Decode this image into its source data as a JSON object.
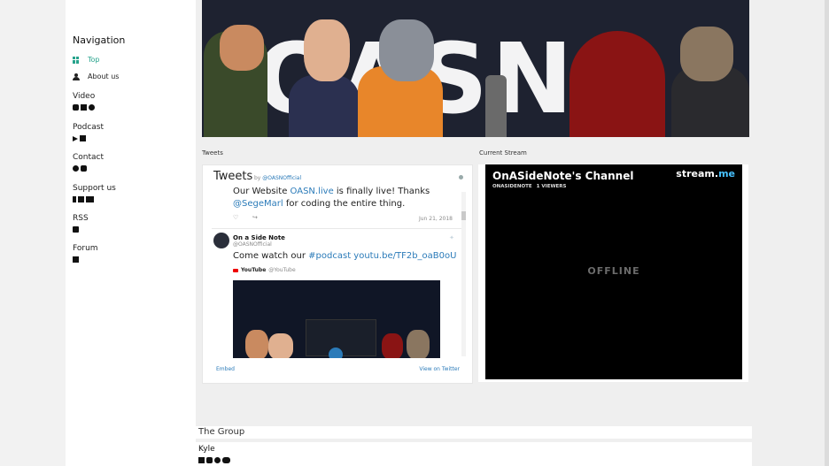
{
  "sidebar": {
    "title": "Navigation",
    "links": [
      {
        "label": "Top",
        "icon": "grid-icon",
        "active": true
      },
      {
        "label": "About us",
        "icon": "person-icon",
        "active": false
      }
    ],
    "sections": [
      {
        "label": "Video",
        "icons": [
          "youtube-icon",
          "twitch-icon",
          "instagram-icon"
        ]
      },
      {
        "label": "Podcast",
        "icons": [
          "google-play-icon",
          "podcast-icon"
        ]
      },
      {
        "label": "Contact",
        "icons": [
          "twitter-icon",
          "discord-icon"
        ]
      },
      {
        "label": "Support us",
        "icons": [
          "patreon-icon",
          "kofi-icon",
          "shop-icon"
        ]
      },
      {
        "label": "RSS",
        "icons": [
          "rss-icon"
        ]
      },
      {
        "label": "Forum",
        "icons": [
          "book-icon"
        ]
      }
    ]
  },
  "banner": {
    "letters": "OASN"
  },
  "tweets": {
    "section_label": "Tweets",
    "header": "Tweets",
    "by_prefix": "by",
    "by_handle": "@OASNOfficial",
    "tweet1_prefix": "Our Website ",
    "tweet1_link": "OASN.live",
    "tweet1_suffix": " is finally live! Thanks",
    "tweet1_line2_link": "@SegeMarl",
    "tweet1_line2_suffix": " for coding the entire thing.",
    "tweet1_date": "Jun 21, 2018",
    "tweet2_name": "On a Side Note",
    "tweet2_handle": "@OASNOfficial",
    "tweet2_prefix": "Come watch our ",
    "tweet2_link": "#podcast youtu.be/TF2b_oaB0oU",
    "embed_source": "YouTube",
    "embed_source_handle": "@YouTube",
    "footer_embed": "Embed",
    "footer_view": "View on Twitter"
  },
  "stream": {
    "section_label": "Current Stream",
    "channel_title": "OnASideNote's Channel",
    "channel_user": "ONASIDENOTE",
    "viewers": "1 VIEWERS",
    "brand_main": "stream.",
    "brand_accent": "me",
    "status": "OFFLINE"
  },
  "group": {
    "title": "The Group",
    "member_name": "Kyle"
  },
  "colors": {
    "accent": "#27a38c",
    "link": "#2b7bb9",
    "banner_bg": "#1e2230"
  }
}
